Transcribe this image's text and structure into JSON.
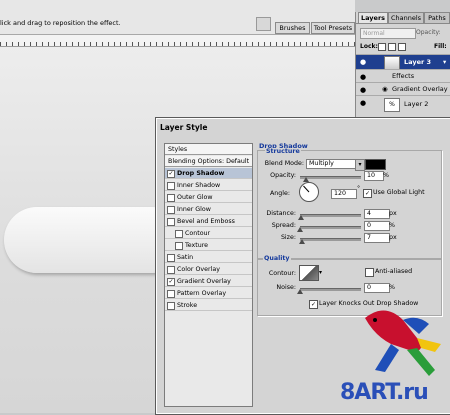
{
  "options_bar": {
    "hint": "lick and drag to reposition the effect.",
    "brushes_tab": "Brushes",
    "tool_presets_tab": "Tool Presets"
  },
  "layers_panel": {
    "tabs": [
      "Layers",
      "Channels",
      "Paths"
    ],
    "blend_mode": "Normal",
    "opacity_label": "Opacity:",
    "lock_label": "Lock:",
    "fill_label": "Fill:",
    "rows": {
      "layer3": "Layer 3",
      "effects": "Effects",
      "gradient_overlay": "Gradient Overlay",
      "layer2": "Layer 2"
    }
  },
  "dialog": {
    "title": "Layer Style",
    "left_list": {
      "styles": "Styles",
      "blending_options": "Blending Options: Default",
      "items": [
        {
          "label": "Drop Shadow",
          "checked": true,
          "selected": true
        },
        {
          "label": "Inner Shadow",
          "checked": false
        },
        {
          "label": "Outer Glow",
          "checked": false
        },
        {
          "label": "Inner Glow",
          "checked": false
        },
        {
          "label": "Bevel and Emboss",
          "checked": false
        },
        {
          "label": "Contour",
          "checked": false,
          "indent": true
        },
        {
          "label": "Texture",
          "checked": false,
          "indent": true
        },
        {
          "label": "Satin",
          "checked": false
        },
        {
          "label": "Color Overlay",
          "checked": false
        },
        {
          "label": "Gradient Overlay",
          "checked": true
        },
        {
          "label": "Pattern Overlay",
          "checked": false
        },
        {
          "label": "Stroke",
          "checked": false
        }
      ]
    },
    "drop_shadow": {
      "section": "Drop Shadow",
      "structure": "Structure",
      "blend_mode_label": "Blend Mode:",
      "blend_mode_value": "Multiply",
      "shadow_color": "#000000",
      "opacity_label": "Opacity:",
      "opacity_value": "10",
      "opacity_slider": 0.1,
      "percent": "%",
      "angle_label": "Angle:",
      "angle_value": "120",
      "degree": "°",
      "use_global_light": "Use Global Light",
      "distance_label": "Distance:",
      "distance_value": "4",
      "distance_slider": 0.02,
      "px": "px",
      "spread_label": "Spread:",
      "spread_value": "0",
      "spread_slider": 0.0,
      "size_label": "Size:",
      "size_value": "7",
      "size_slider": 0.03,
      "quality": "Quality",
      "contour_label": "Contour:",
      "anti_aliased": "Anti-aliased",
      "noise_label": "Noise:",
      "noise_value": "0",
      "noise_slider": 0.0,
      "knockout": "Layer Knocks Out Drop Shadow"
    }
  },
  "watermark": "8ART.ru"
}
